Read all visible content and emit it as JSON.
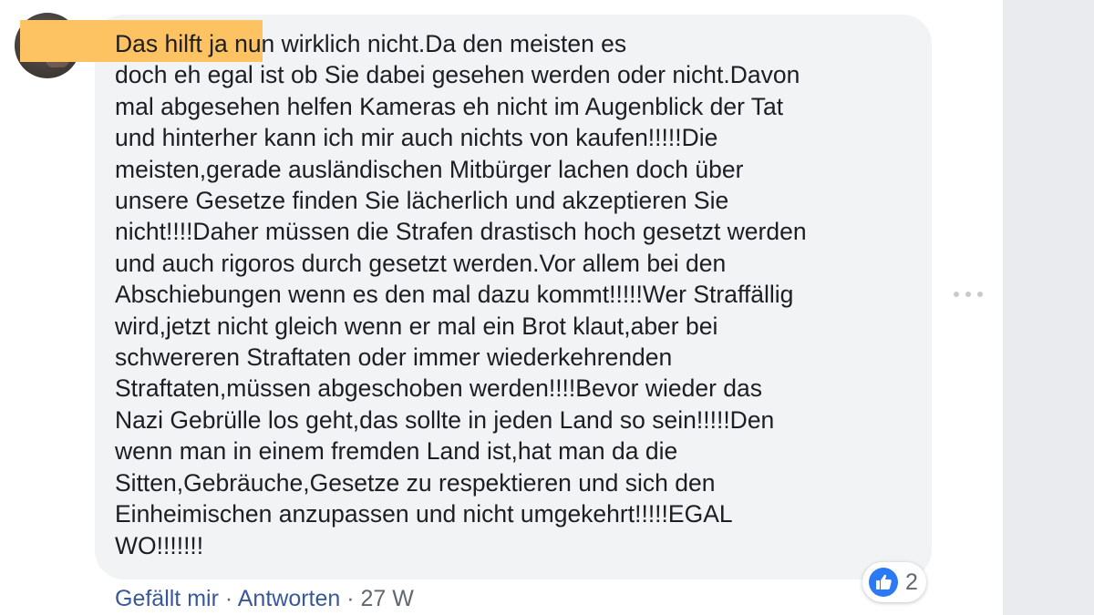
{
  "comment": {
    "text": "Das hilft ja nun wirklich nicht.Da den meisten es\ndoch eh egal ist ob Sie dabei gesehen werden oder nicht.Davon\nmal abgesehen helfen Kameras eh nicht im Augenblick der Tat\nund hinterher kann ich mir auch nichts von kaufen!!!!!Die\nmeisten,gerade ausländischen Mitbürger lachen doch über\nunsere Gesetze finden Sie lächerlich und akzeptieren Sie\nnicht!!!!Daher müssen die Strafen drastisch hoch gesetzt werden\nund auch rigoros durch gesetzt werden.Vor allem bei den\nAbschiebungen wenn es den mal dazu kommt!!!!!Wer Straffällig\nwird,jetzt nicht gleich wenn er mal ein Brot klaut,aber bei\nschwereren Straftaten oder immer wiederkehrenden\nStraftaten,müssen abgeschoben werden!!!!Bevor wieder das\nNazi Gebrülle los geht,das sollte in jeden Land so sein!!!!!Den\nwenn man in einem fremden Land ist,hat man da die\nSitten,Gebräuche,Gesetze zu respektieren und sich den\nEinheimischen anzupassen und nicht umgekehrt!!!!!EGAL\nWO!!!!!!!",
    "reaction_icon": "like-icon",
    "reaction_count": "2"
  },
  "actions": {
    "like_label": "Gefällt mir",
    "separator": " · ",
    "reply_label": "Antworten",
    "timestamp": "27 W"
  },
  "colors": {
    "bubble": "#f2f3f5",
    "link": "#385898",
    "like_blue": "#2c79f6",
    "redaction": "#fdc261"
  }
}
